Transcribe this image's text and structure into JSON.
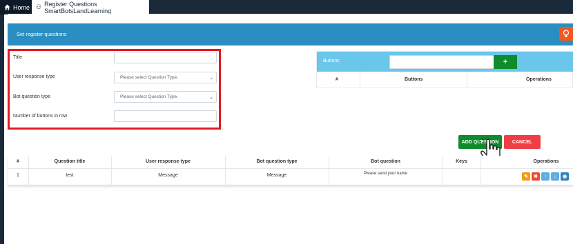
{
  "tabs": {
    "home": "Home",
    "active": "Register Questions SmartBotsLandLearning"
  },
  "header": {
    "title": "Set register questions"
  },
  "form": {
    "title_label": "Title",
    "title_value": "",
    "response_label": "User response type",
    "response_value": "Please select Question Type.",
    "botq_label": "Bot question type",
    "botq_value": "Please select Question Type.",
    "buttons_row_label": "Number of buttons in row",
    "buttons_row_value": ""
  },
  "buttons_panel": {
    "label": "Buttons",
    "add_symbol": "+",
    "columns": [
      "#",
      "Buttons",
      "Operations"
    ]
  },
  "actions": {
    "add_question": "ADD QUESTION",
    "cancel": "CANCEL"
  },
  "table": {
    "columns": [
      "#",
      "Question title",
      "User response type",
      "Bot question type",
      "Bot question",
      "Keys",
      "Operations"
    ],
    "rows": [
      {
        "num": "1",
        "title": "test",
        "response": "Message",
        "bot_type": "Message",
        "bot_question": "Please send your name",
        "keys": ""
      }
    ]
  },
  "colors": {
    "header": "#2a8ec2",
    "buttons_panel": "#6ac6ea",
    "add": "#0f8a2c",
    "cancel": "#ef3e45",
    "highlight": "#e11b22"
  },
  "operation_icons": [
    "edit-icon",
    "delete-icon",
    "move-up-icon",
    "move-down-icon",
    "view-icon"
  ]
}
